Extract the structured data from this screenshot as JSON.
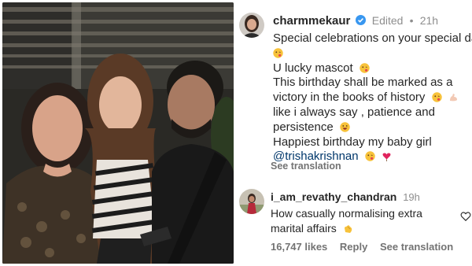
{
  "post": {
    "username": "charmmekaur",
    "edited_label": "Edited",
    "separator": "•",
    "time": "21h",
    "caption_lines": [
      "Special celebrations on your special day",
      "U lucky mascot",
      "This birthday shall be marked as a",
      "victory in the books of history",
      "like i always say , patience and",
      "persistence",
      "Happiest birthday my baby girl"
    ],
    "mention": "@trishakrishnan",
    "see_translation": "See translation"
  },
  "reply": {
    "username": "i_am_revathy_chandran",
    "time": "19h",
    "text_lines": [
      "How casually normalising extra",
      "marital affairs"
    ],
    "likes": "16,747 likes",
    "reply_label": "Reply",
    "see_translation": "See translation"
  },
  "icons": {
    "verified": "verified-badge-icon",
    "kiss_emoji": "face-blowing-kiss-emoji",
    "flex_emoji": "flexed-biceps-emoji",
    "grin_emoji": "grinning-face-emoji",
    "heart_emoji": "heart-emoji",
    "clap_emoji": "clapping-hands-emoji",
    "like": "heart-outline-icon"
  },
  "colors": {
    "verified": "#3897f0",
    "mention": "#00376b",
    "muted": "#8e8e8e"
  }
}
